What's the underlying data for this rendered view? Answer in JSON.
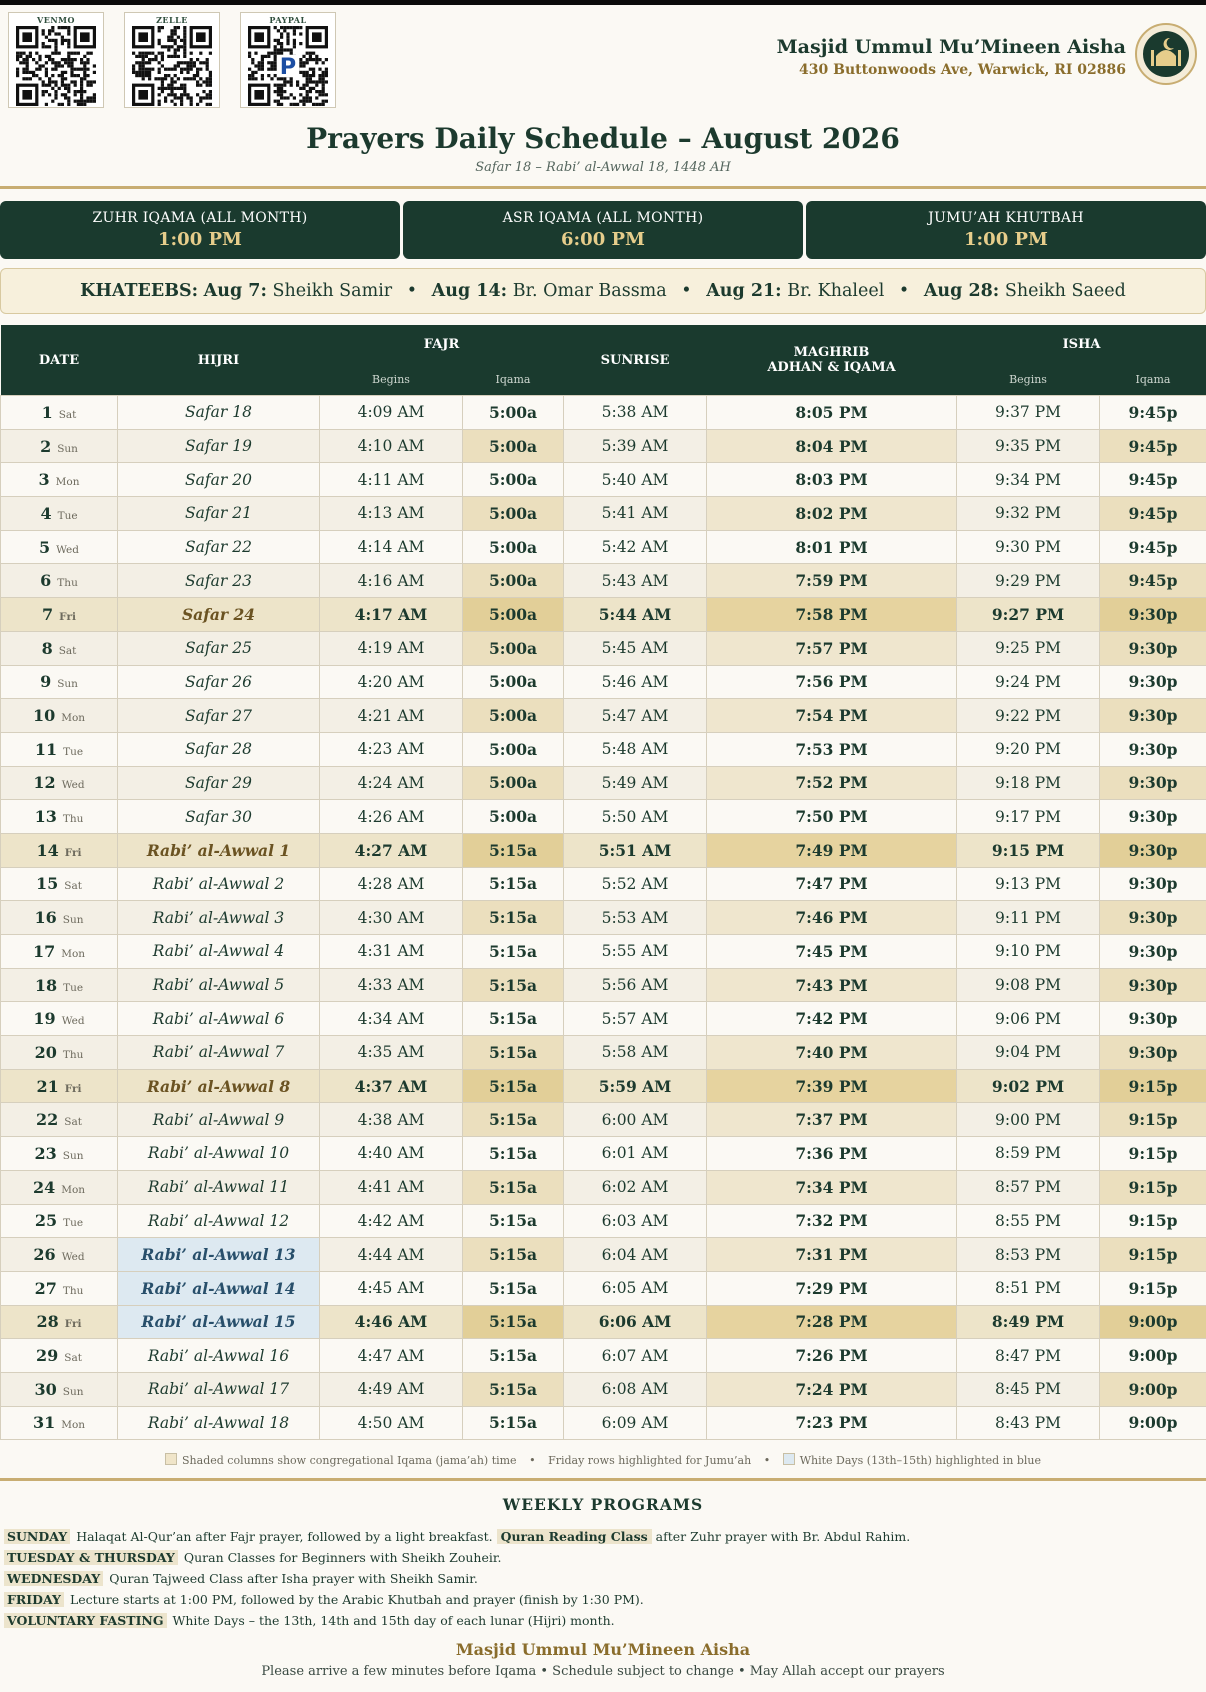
{
  "qr_codes": [
    {
      "label": "VENMO",
      "icon": "qr-code-icon"
    },
    {
      "label": "ZELLE",
      "icon": "qr-code-icon"
    },
    {
      "label": "PAYPAL",
      "icon": "qr-code-icon"
    }
  ],
  "header": {
    "mosque_name": "Masjid Ummul Mu’Mineen Aisha",
    "address": "430 Buttonwoods Ave, Warwick, RI 02886",
    "title": "Prayers Daily Schedule – August 2026",
    "subtitle": "Safar 18 – Rabi’ al-Awwal 18, 1448 AH"
  },
  "cards": [
    {
      "label": "ZUHR IQAMA (ALL MONTH)",
      "value": "1:00 PM"
    },
    {
      "label": "ASR IQAMA (ALL MONTH)",
      "value": "6:00 PM"
    },
    {
      "label": "JUMU’AH KHUTBAH",
      "value": "1:00 PM"
    }
  ],
  "khateebs": {
    "label": "KHATEEBS:",
    "entries": [
      {
        "date": "Aug 7:",
        "name": "Sheikh Samir"
      },
      {
        "date": "Aug 14:",
        "name": "Br. Omar Bassma"
      },
      {
        "date": "Aug 21:",
        "name": "Br. Khaleel"
      },
      {
        "date": "Aug 28:",
        "name": "Sheikh Saeed"
      }
    ]
  },
  "table_headers": {
    "date": "DATE",
    "hijri": "HIJRI",
    "fajr": "FAJR",
    "sunrise": "SUNRISE",
    "maghrib": "MAGHRIB",
    "maghrib_sub": "ADHAN & IQAMA",
    "isha": "ISHA",
    "begins": "Begins",
    "iqama": "Iqama"
  },
  "rows": [
    {
      "day": "1",
      "wd": "Sat",
      "hijri": "Safar 18",
      "fajr": "4:09 AM",
      "fajr_iq": "5:00a",
      "sunrise": "5:38 AM",
      "maghrib": "8:05 PM",
      "isha": "9:37 PM",
      "isha_iq": "9:45p"
    },
    {
      "day": "2",
      "wd": "Sun",
      "hijri": "Safar 19",
      "fajr": "4:10 AM",
      "fajr_iq": "5:00a",
      "sunrise": "5:39 AM",
      "maghrib": "8:04 PM",
      "isha": "9:35 PM",
      "isha_iq": "9:45p"
    },
    {
      "day": "3",
      "wd": "Mon",
      "hijri": "Safar 20",
      "fajr": "4:11 AM",
      "fajr_iq": "5:00a",
      "sunrise": "5:40 AM",
      "maghrib": "8:03 PM",
      "isha": "9:34 PM",
      "isha_iq": "9:45p"
    },
    {
      "day": "4",
      "wd": "Tue",
      "hijri": "Safar 21",
      "fajr": "4:13 AM",
      "fajr_iq": "5:00a",
      "sunrise": "5:41 AM",
      "maghrib": "8:02 PM",
      "isha": "9:32 PM",
      "isha_iq": "9:45p"
    },
    {
      "day": "5",
      "wd": "Wed",
      "hijri": "Safar 22",
      "fajr": "4:14 AM",
      "fajr_iq": "5:00a",
      "sunrise": "5:42 AM",
      "maghrib": "8:01 PM",
      "isha": "9:30 PM",
      "isha_iq": "9:45p"
    },
    {
      "day": "6",
      "wd": "Thu",
      "hijri": "Safar 23",
      "fajr": "4:16 AM",
      "fajr_iq": "5:00a",
      "sunrise": "5:43 AM",
      "maghrib": "7:59 PM",
      "isha": "9:29 PM",
      "isha_iq": "9:45p"
    },
    {
      "day": "7",
      "wd": "Fri",
      "hijri": "Safar 24",
      "fajr": "4:17 AM",
      "fajr_iq": "5:00a",
      "sunrise": "5:44 AM",
      "maghrib": "7:58 PM",
      "isha": "9:27 PM",
      "isha_iq": "9:30p"
    },
    {
      "day": "8",
      "wd": "Sat",
      "hijri": "Safar 25",
      "fajr": "4:19 AM",
      "fajr_iq": "5:00a",
      "sunrise": "5:45 AM",
      "maghrib": "7:57 PM",
      "isha": "9:25 PM",
      "isha_iq": "9:30p"
    },
    {
      "day": "9",
      "wd": "Sun",
      "hijri": "Safar 26",
      "fajr": "4:20 AM",
      "fajr_iq": "5:00a",
      "sunrise": "5:46 AM",
      "maghrib": "7:56 PM",
      "isha": "9:24 PM",
      "isha_iq": "9:30p"
    },
    {
      "day": "10",
      "wd": "Mon",
      "hijri": "Safar 27",
      "fajr": "4:21 AM",
      "fajr_iq": "5:00a",
      "sunrise": "5:47 AM",
      "maghrib": "7:54 PM",
      "isha": "9:22 PM",
      "isha_iq": "9:30p"
    },
    {
      "day": "11",
      "wd": "Tue",
      "hijri": "Safar 28",
      "fajr": "4:23 AM",
      "fajr_iq": "5:00a",
      "sunrise": "5:48 AM",
      "maghrib": "7:53 PM",
      "isha": "9:20 PM",
      "isha_iq": "9:30p"
    },
    {
      "day": "12",
      "wd": "Wed",
      "hijri": "Safar 29",
      "fajr": "4:24 AM",
      "fajr_iq": "5:00a",
      "sunrise": "5:49 AM",
      "maghrib": "7:52 PM",
      "isha": "9:18 PM",
      "isha_iq": "9:30p"
    },
    {
      "day": "13",
      "wd": "Thu",
      "hijri": "Safar 30",
      "fajr": "4:26 AM",
      "fajr_iq": "5:00a",
      "sunrise": "5:50 AM",
      "maghrib": "7:50 PM",
      "isha": "9:17 PM",
      "isha_iq": "9:30p"
    },
    {
      "day": "14",
      "wd": "Fri",
      "hijri": "Rabi’ al-Awwal 1",
      "fajr": "4:27 AM",
      "fajr_iq": "5:15a",
      "sunrise": "5:51 AM",
      "maghrib": "7:49 PM",
      "isha": "9:15 PM",
      "isha_iq": "9:30p"
    },
    {
      "day": "15",
      "wd": "Sat",
      "hijri": "Rabi’ al-Awwal 2",
      "fajr": "4:28 AM",
      "fajr_iq": "5:15a",
      "sunrise": "5:52 AM",
      "maghrib": "7:47 PM",
      "isha": "9:13 PM",
      "isha_iq": "9:30p"
    },
    {
      "day": "16",
      "wd": "Sun",
      "hijri": "Rabi’ al-Awwal 3",
      "fajr": "4:30 AM",
      "fajr_iq": "5:15a",
      "sunrise": "5:53 AM",
      "maghrib": "7:46 PM",
      "isha": "9:11 PM",
      "isha_iq": "9:30p"
    },
    {
      "day": "17",
      "wd": "Mon",
      "hijri": "Rabi’ al-Awwal 4",
      "fajr": "4:31 AM",
      "fajr_iq": "5:15a",
      "sunrise": "5:55 AM",
      "maghrib": "7:45 PM",
      "isha": "9:10 PM",
      "isha_iq": "9:30p"
    },
    {
      "day": "18",
      "wd": "Tue",
      "hijri": "Rabi’ al-Awwal 5",
      "fajr": "4:33 AM",
      "fajr_iq": "5:15a",
      "sunrise": "5:56 AM",
      "maghrib": "7:43 PM",
      "isha": "9:08 PM",
      "isha_iq": "9:30p"
    },
    {
      "day": "19",
      "wd": "Wed",
      "hijri": "Rabi’ al-Awwal 6",
      "fajr": "4:34 AM",
      "fajr_iq": "5:15a",
      "sunrise": "5:57 AM",
      "maghrib": "7:42 PM",
      "isha": "9:06 PM",
      "isha_iq": "9:30p"
    },
    {
      "day": "20",
      "wd": "Thu",
      "hijri": "Rabi’ al-Awwal 7",
      "fajr": "4:35 AM",
      "fajr_iq": "5:15a",
      "sunrise": "5:58 AM",
      "maghrib": "7:40 PM",
      "isha": "9:04 PM",
      "isha_iq": "9:30p"
    },
    {
      "day": "21",
      "wd": "Fri",
      "hijri": "Rabi’ al-Awwal 8",
      "fajr": "4:37 AM",
      "fajr_iq": "5:15a",
      "sunrise": "5:59 AM",
      "maghrib": "7:39 PM",
      "isha": "9:02 PM",
      "isha_iq": "9:15p"
    },
    {
      "day": "22",
      "wd": "Sat",
      "hijri": "Rabi’ al-Awwal 9",
      "fajr": "4:38 AM",
      "fajr_iq": "5:15a",
      "sunrise": "6:00 AM",
      "maghrib": "7:37 PM",
      "isha": "9:00 PM",
      "isha_iq": "9:15p"
    },
    {
      "day": "23",
      "wd": "Sun",
      "hijri": "Rabi’ al-Awwal 10",
      "fajr": "4:40 AM",
      "fajr_iq": "5:15a",
      "sunrise": "6:01 AM",
      "maghrib": "7:36 PM",
      "isha": "8:59 PM",
      "isha_iq": "9:15p"
    },
    {
      "day": "24",
      "wd": "Mon",
      "hijri": "Rabi’ al-Awwal 11",
      "fajr": "4:41 AM",
      "fajr_iq": "5:15a",
      "sunrise": "6:02 AM",
      "maghrib": "7:34 PM",
      "isha": "8:57 PM",
      "isha_iq": "9:15p"
    },
    {
      "day": "25",
      "wd": "Tue",
      "hijri": "Rabi’ al-Awwal 12",
      "fajr": "4:42 AM",
      "fajr_iq": "5:15a",
      "sunrise": "6:03 AM",
      "maghrib": "7:32 PM",
      "isha": "8:55 PM",
      "isha_iq": "9:15p"
    },
    {
      "day": "26",
      "wd": "Wed",
      "hijri": "Rabi’ al-Awwal 13",
      "fajr": "4:44 AM",
      "fajr_iq": "5:15a",
      "sunrise": "6:04 AM",
      "maghrib": "7:31 PM",
      "isha": "8:53 PM",
      "isha_iq": "9:15p",
      "white": true
    },
    {
      "day": "27",
      "wd": "Thu",
      "hijri": "Rabi’ al-Awwal 14",
      "fajr": "4:45 AM",
      "fajr_iq": "5:15a",
      "sunrise": "6:05 AM",
      "maghrib": "7:29 PM",
      "isha": "8:51 PM",
      "isha_iq": "9:15p",
      "white": true
    },
    {
      "day": "28",
      "wd": "Fri",
      "hijri": "Rabi’ al-Awwal 15",
      "fajr": "4:46 AM",
      "fajr_iq": "5:15a",
      "sunrise": "6:06 AM",
      "maghrib": "7:28 PM",
      "isha": "8:49 PM",
      "isha_iq": "9:00p",
      "white": true
    },
    {
      "day": "29",
      "wd": "Sat",
      "hijri": "Rabi’ al-Awwal 16",
      "fajr": "4:47 AM",
      "fajr_iq": "5:15a",
      "sunrise": "6:07 AM",
      "maghrib": "7:26 PM",
      "isha": "8:47 PM",
      "isha_iq": "9:00p"
    },
    {
      "day": "30",
      "wd": "Sun",
      "hijri": "Rabi’ al-Awwal 17",
      "fajr": "4:49 AM",
      "fajr_iq": "5:15a",
      "sunrise": "6:08 AM",
      "maghrib": "7:24 PM",
      "isha": "8:45 PM",
      "isha_iq": "9:00p"
    },
    {
      "day": "31",
      "wd": "Mon",
      "hijri": "Rabi’ al-Awwal 18",
      "fajr": "4:50 AM",
      "fajr_iq": "5:15a",
      "sunrise": "6:09 AM",
      "maghrib": "7:23 PM",
      "isha": "8:43 PM",
      "isha_iq": "9:00p"
    }
  ],
  "legend": {
    "shaded": "Shaded columns show congregational Iqama (jama’ah) time",
    "friday": "Friday rows highlighted for Jumu’ah",
    "white_days": "White Days (13th–15th) highlighted in blue",
    "bullet": "•"
  },
  "weekly": {
    "title": "WEEKLY PROGRAMS",
    "sunday_day": "SUNDAY",
    "sunday_text1": "Halaqat Al-Qur’an after Fajr prayer, followed by a light breakfast.",
    "sunday_highlight": "Quran Reading Class",
    "sunday_text2": "after Zuhr prayer with Br. Abdul Rahim.",
    "tt_day": "TUESDAY & THURSDAY",
    "tt_text": "Quran Classes for Beginners with Sheikh Zouheir.",
    "wed_day": "WEDNESDAY",
    "wed_text": "Quran Tajweed Class after Isha prayer with Sheikh Samir.",
    "fri_day": "FRIDAY",
    "fri_text": "Lecture starts at 1:00 PM, followed by the Arabic Khutbah and prayer (finish by 1:30 PM).",
    "vf_day": "VOLUNTARY FASTING",
    "vf_text": "White Days – the 13th, 14th and 15th day of each lunar (Hijri) month."
  },
  "footer": {
    "name": "Masjid Ummul Mu’Mineen Aisha",
    "note": "Please arrive a few minutes before Iqama • Schedule subject to change • May Allah accept our prayers"
  },
  "colors": {
    "primary": "#1a3a2e",
    "gold": "#8a6d2c",
    "iqama_shade": "#f0e5c9",
    "friday_shade": "#ede4c9",
    "white_days": "#dde9f1"
  }
}
